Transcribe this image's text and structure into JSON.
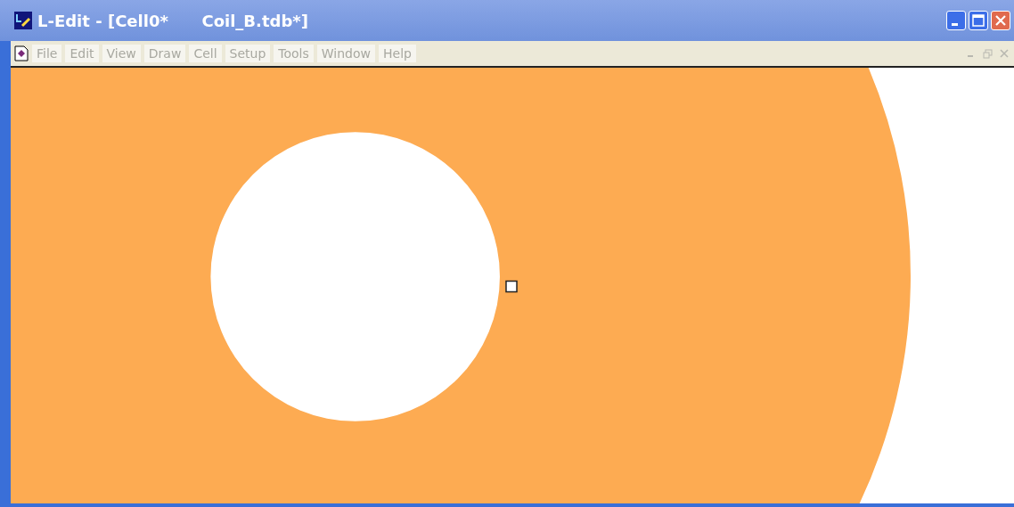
{
  "window": {
    "title": "L-Edit - [Cell0*      Coil_B.tdb*]"
  },
  "menu": [
    {
      "label": "File",
      "disabled": true
    },
    {
      "label": "Edit",
      "disabled": true
    },
    {
      "label": "View",
      "disabled": true
    },
    {
      "label": "Draw",
      "disabled": true
    },
    {
      "label": "Cell",
      "disabled": true
    },
    {
      "label": "Setup",
      "disabled": true
    },
    {
      "label": "Tools",
      "disabled": true
    },
    {
      "label": "Window",
      "disabled": true
    },
    {
      "label": "Help",
      "disabled": true
    }
  ]
}
